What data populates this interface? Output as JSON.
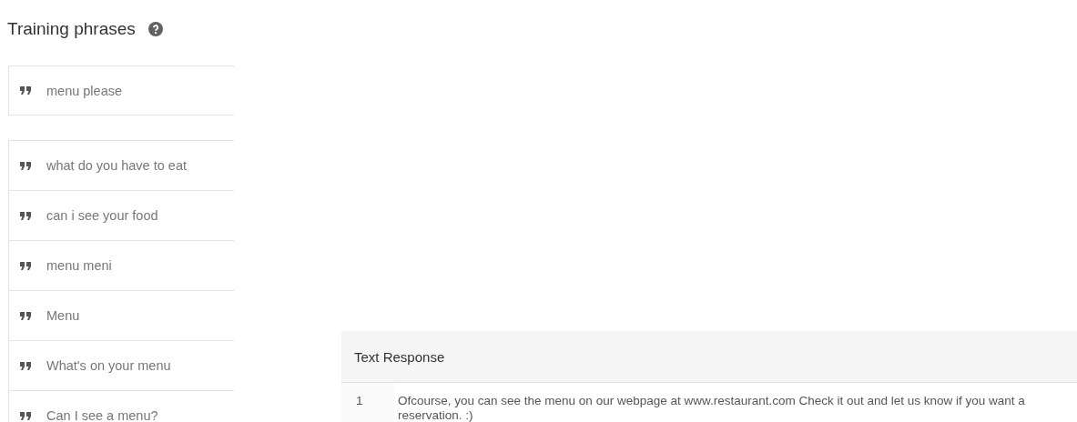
{
  "training_phrases": {
    "title": "Training phrases",
    "input_phrase": "menu please",
    "phrases": [
      "what do you have to eat",
      "can i see your food",
      "menu meni",
      "Menu",
      "What's on your menu",
      "Can I see a menu?"
    ]
  },
  "text_response": {
    "title": "Text Response",
    "rows": [
      {
        "number": "1",
        "text": "Ofcourse, you can see the menu on our webpage at www.restaurant.com Check it out and let us know if you want a reservation. :)"
      }
    ]
  }
}
